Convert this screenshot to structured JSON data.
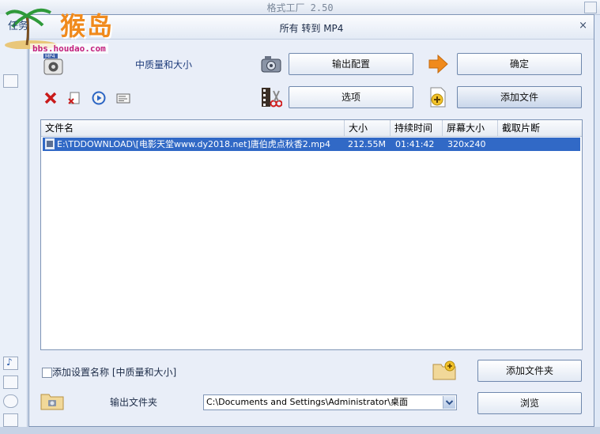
{
  "main_window": {
    "title": "格式工厂 2.50"
  },
  "watermark": {
    "text": "猴岛",
    "url": "bbs.houdao.com",
    "side_letters": "任务"
  },
  "dialog": {
    "title": "所有 转到 MP4",
    "close_glyph": "×",
    "quality_label": "中质量和大小",
    "format_badge": "MP4",
    "buttons": {
      "output_config": "输出配置",
      "ok": "确定",
      "options": "选项",
      "add_file": "添加文件",
      "add_folder": "添加文件夹",
      "browse": "浏览"
    },
    "columns": [
      "文件名",
      "大小",
      "持续时间",
      "屏幕大小",
      "截取片断"
    ],
    "files": [
      {
        "name": "E:\\TDDOWNLOAD\\[电影天堂www.dy2018.net]唐伯虎点秋香2.mp4",
        "size": "212.55M",
        "duration": "01:41:42",
        "screen_size": "320x240",
        "clip": ""
      }
    ],
    "add_setting_name": {
      "checked": false,
      "label": "添加设置名称 [中质量和大小]"
    },
    "output_folder_label": "输出文件夹",
    "output_folder_value": "C:\\Documents and Settings\\Administrator\\桌面"
  },
  "icons": {
    "format": "mp4-film-icon",
    "output_config": "camera-settings-icon",
    "ok": "orange-arrow-right-icon",
    "options": "film-scissors-icon",
    "add_file": "add-document-icon",
    "delete": "red-x-icon",
    "clear": "doc-clear-icon",
    "play": "play-circle-icon",
    "info": "info-card-icon",
    "add_folder": "add-folder-icon",
    "output_folder": "folder-icon"
  },
  "colors": {
    "selection": "#3169c6",
    "ok_arrow": "#f08a1c",
    "quality_text": "#1d3b7a"
  }
}
